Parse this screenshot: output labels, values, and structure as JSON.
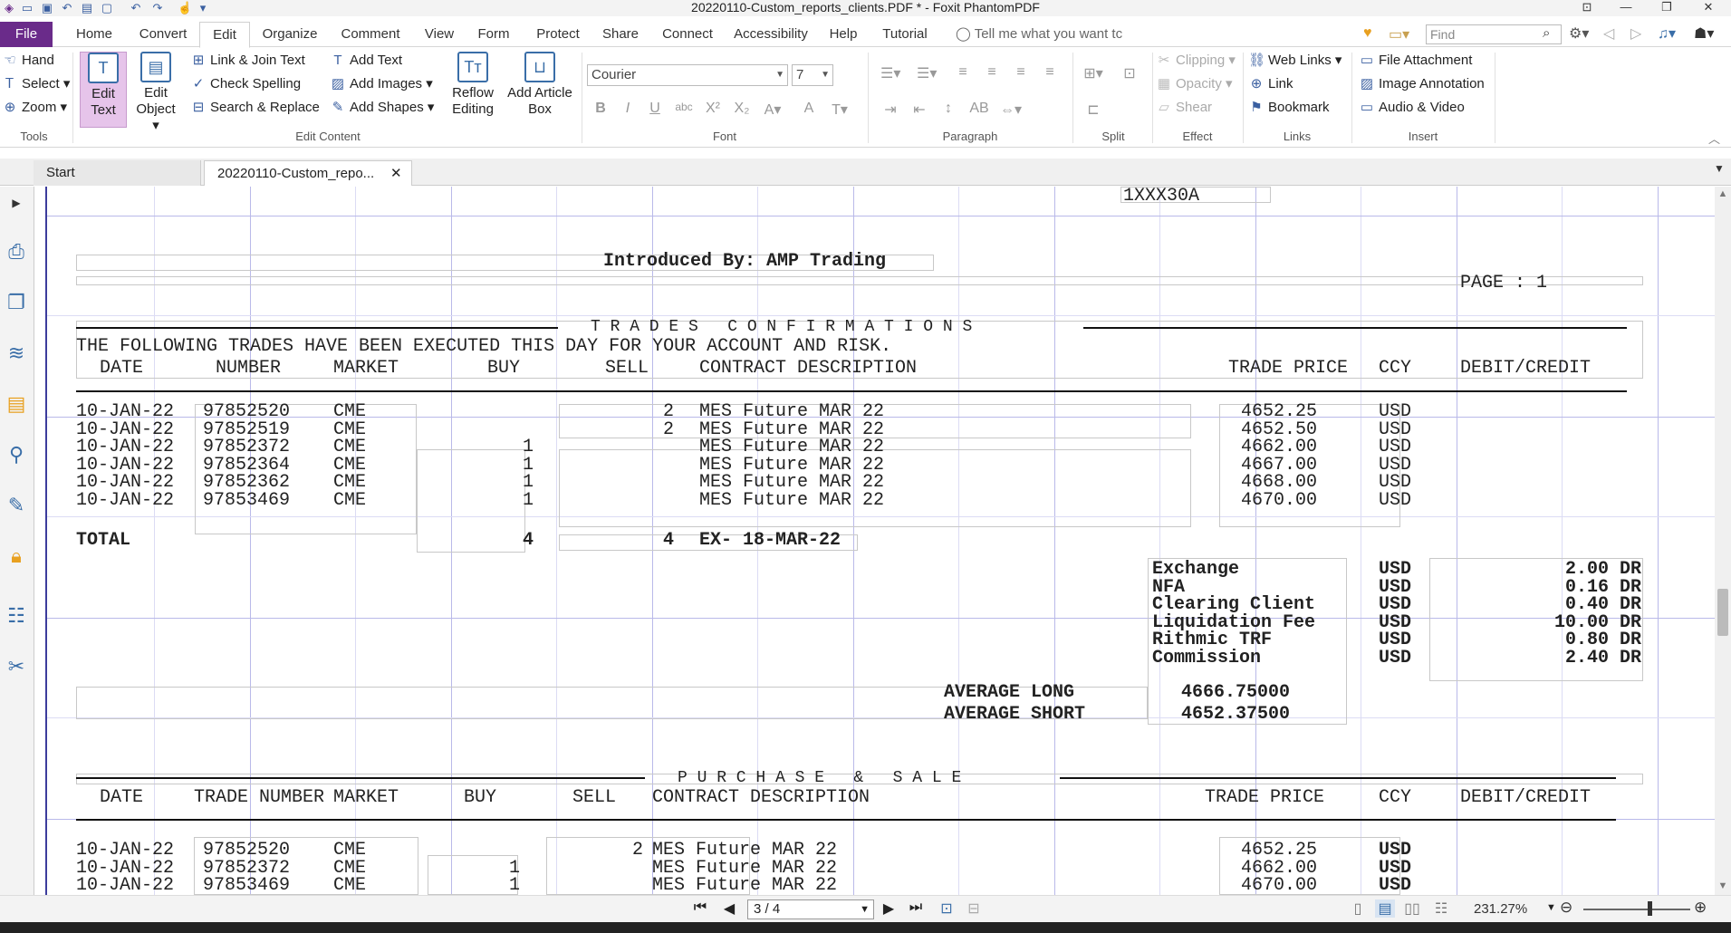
{
  "window": {
    "title": "20220110-Custom_reports_clients.PDF * - Foxit PhantomPDF"
  },
  "menu": {
    "file": "File",
    "tabs": [
      "Home",
      "Convert",
      "Edit",
      "Organize",
      "Comment",
      "View",
      "Form",
      "Protect",
      "Share",
      "Connect",
      "Accessibility",
      "Help",
      "Tutorial"
    ],
    "active_tab": "Edit",
    "tell_me": "Tell me what you want tc",
    "find_placeholder": "Find"
  },
  "ribbon": {
    "tools": {
      "hand": "Hand",
      "select": "Select",
      "zoom": "Zoom",
      "label": "Tools"
    },
    "edit_content": {
      "edit_text": "Edit Text",
      "edit_object": "Edit Object",
      "link_join": "Link & Join Text",
      "check_spelling": "Check Spelling",
      "search_replace": "Search & Replace",
      "add_text": "Add Text",
      "add_images": "Add Images",
      "add_shapes": "Add Shapes",
      "reflow": "Reflow Editing",
      "add_article": "Add Article Box",
      "label": "Edit Content"
    },
    "font": {
      "family": "Courier",
      "size": "7",
      "label": "Font"
    },
    "paragraph": {
      "label": "Paragraph"
    },
    "split": {
      "label": "Split"
    },
    "effect": {
      "clipping": "Clipping",
      "opacity": "Opacity",
      "shear": "Shear",
      "label": "Effect"
    },
    "links": {
      "web_links": "Web Links",
      "link": "Link",
      "bookmark": "Bookmark",
      "label": "Links"
    },
    "insert": {
      "file_attachment": "File Attachment",
      "image_annotation": "Image Annotation",
      "audio_video": "Audio & Video",
      "label": "Insert"
    }
  },
  "doc_tabs": {
    "start": "Start",
    "doc": "20220110-Custom_repo..."
  },
  "document": {
    "account": "1XXX30A",
    "introduced_by": "Introduced By: AMP Trading",
    "page": "PAGE : 1",
    "section1_title": "T R A D E S   C O N F I R M A T I O N S",
    "notice": "THE FOLLOWING TRADES HAVE BEEN EXECUTED THIS DAY FOR YOUR ACCOUNT AND RISK.",
    "headers1": {
      "date": "DATE",
      "number": "NUMBER",
      "market": "MARKET",
      "buy": "BUY",
      "sell": "SELL",
      "contract": "CONTRACT DESCRIPTION",
      "price": "TRADE PRICE",
      "ccy": "CCY",
      "debit": "DEBIT/CREDIT"
    },
    "trades": [
      {
        "date": "10-JAN-22",
        "number": "97852520",
        "market": "CME",
        "buy": "",
        "sell": "2",
        "desc": "MES Future MAR 22",
        "price": "4652.25",
        "ccy": "USD"
      },
      {
        "date": "10-JAN-22",
        "number": "97852519",
        "market": "CME",
        "buy": "",
        "sell": "2",
        "desc": "MES Future MAR 22",
        "price": "4652.50",
        "ccy": "USD"
      },
      {
        "date": "10-JAN-22",
        "number": "97852372",
        "market": "CME",
        "buy": "1",
        "sell": "",
        "desc": "MES Future MAR 22",
        "price": "4662.00",
        "ccy": "USD"
      },
      {
        "date": "10-JAN-22",
        "number": "97852364",
        "market": "CME",
        "buy": "1",
        "sell": "",
        "desc": "MES Future MAR 22",
        "price": "4667.00",
        "ccy": "USD"
      },
      {
        "date": "10-JAN-22",
        "number": "97852362",
        "market": "CME",
        "buy": "1",
        "sell": "",
        "desc": "MES Future MAR 22",
        "price": "4668.00",
        "ccy": "USD"
      },
      {
        "date": "10-JAN-22",
        "number": "97853469",
        "market": "CME",
        "buy": "1",
        "sell": "",
        "desc": "MES Future MAR 22",
        "price": "4670.00",
        "ccy": "USD"
      }
    ],
    "total": {
      "label": "TOTAL",
      "buy": "4",
      "sell": "4",
      "desc": "EX- 18-MAR-22"
    },
    "fees": [
      {
        "name": "Exchange",
        "ccy": "USD",
        "amount": "2.00 DR"
      },
      {
        "name": "NFA",
        "ccy": "USD",
        "amount": "0.16 DR"
      },
      {
        "name": "Clearing Client",
        "ccy": "USD",
        "amount": "0.40 DR"
      },
      {
        "name": "Liquidation Fee",
        "ccy": "USD",
        "amount": "10.00 DR"
      },
      {
        "name": "Rithmic TRF",
        "ccy": "USD",
        "amount": "0.80 DR"
      },
      {
        "name": "Commission",
        "ccy": "USD",
        "amount": "2.40 DR"
      }
    ],
    "average_long": {
      "label": "AVERAGE LONG",
      "value": "4666.75000"
    },
    "average_short": {
      "label": "AVERAGE SHORT",
      "value": "4652.37500"
    },
    "section2_title": "P U R C H A S E   &   S A L E",
    "headers2": {
      "date": "DATE",
      "number": "TRADE NUMBER",
      "market": "MARKET",
      "buy": "BUY",
      "sell": "SELL",
      "contract": "CONTRACT DESCRIPTION",
      "price": "TRADE PRICE",
      "ccy": "CCY",
      "debit": "DEBIT/CREDIT"
    },
    "ps_rows": [
      {
        "date": "10-JAN-22",
        "number": "97852520",
        "market": "CME",
        "buy": "",
        "sell": "2",
        "desc": "MES Future MAR 22",
        "price": "4652.25",
        "ccy": "USD"
      },
      {
        "date": "10-JAN-22",
        "number": "97852372",
        "market": "CME",
        "buy": "1",
        "sell": "",
        "desc": "MES Future MAR 22",
        "price": "4662.00",
        "ccy": "USD"
      },
      {
        "date": "10-JAN-22",
        "number": "97853469",
        "market": "CME",
        "buy": "1",
        "sell": "",
        "desc": "MES Future MAR 22",
        "price": "4670.00",
        "ccy": "USD"
      }
    ]
  },
  "status": {
    "page_indicator": "3 / 4",
    "zoom": "231.27%"
  }
}
